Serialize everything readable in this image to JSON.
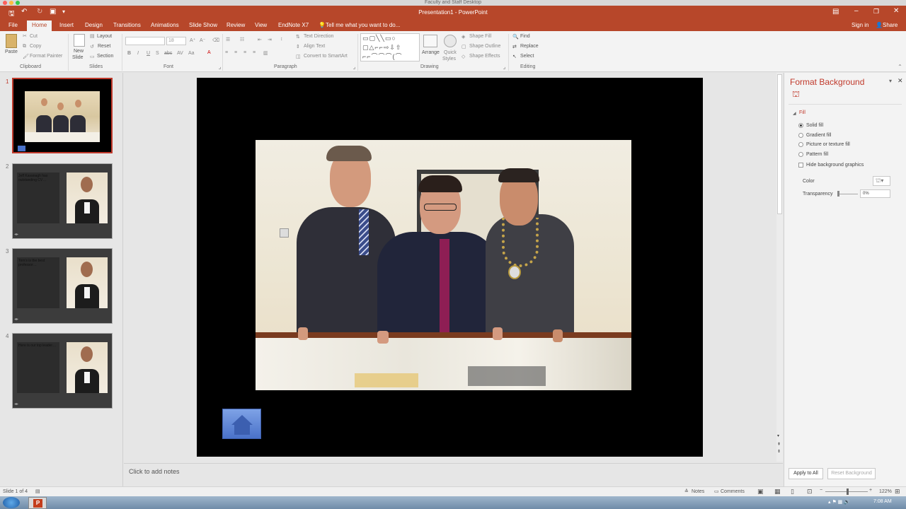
{
  "mac": {
    "title": "Faculty and Staff Desktop"
  },
  "titlebar": {
    "title": "Presentation1 - PowerPoint"
  },
  "tabs": {
    "items": [
      "File",
      "Home",
      "Insert",
      "Design",
      "Transitions",
      "Animations",
      "Slide Show",
      "Review",
      "View",
      "EndNote X7"
    ],
    "active": "Home",
    "tell_me": "Tell me what you want to do...",
    "sign_in": "Sign in",
    "share": "Share"
  },
  "ribbon": {
    "clipboard": {
      "paste": "Paste",
      "cut": "Cut",
      "copy": "Copy",
      "format_painter": "Format Painter",
      "group": "Clipboard"
    },
    "slides": {
      "new_slide": "New",
      "new_slide2": "Slide",
      "layout": "Layout",
      "reset": "Reset",
      "section": "Section",
      "group": "Slides"
    },
    "font": {
      "font_size": "18",
      "bold": "B",
      "italic": "I",
      "underline": "U",
      "strike": "S",
      "group": "Font"
    },
    "paragraph": {
      "text_direction": "Text Direction",
      "align_text": "Align Text",
      "convert_smartart": "Convert to SmartArt",
      "group": "Paragraph"
    },
    "drawing": {
      "arrange": "Arrange",
      "quick_styles": "Quick",
      "quick_styles2": "Styles",
      "shape_fill": "Shape Fill",
      "shape_outline": "Shape Outline",
      "shape_effects": "Shape Effects",
      "group": "Drawing"
    },
    "editing": {
      "find": "Find",
      "replace": "Replace",
      "select": "Select",
      "group": "Editing"
    }
  },
  "thumbs": [
    {
      "num": "1",
      "text": ""
    },
    {
      "num": "2",
      "text": "Jeff Kavanagh has outstanding CV…"
    },
    {
      "num": "3",
      "text": "Tom's is the best professor…"
    },
    {
      "num": "4",
      "text": "Here is our top leader…"
    }
  ],
  "notes": {
    "placeholder": "Click to add notes"
  },
  "pane": {
    "title": "Format Background",
    "fill_header": "Fill",
    "options": [
      "Solid fill",
      "Gradient fill",
      "Picture or texture fill",
      "Pattern fill"
    ],
    "selected": "Solid fill",
    "hide_bg": "Hide background graphics",
    "color_label": "Color",
    "transparency_label": "Transparency",
    "transparency_value": "0%",
    "apply_all": "Apply to All",
    "reset_bg": "Reset Background"
  },
  "status": {
    "slide_of": "Slide 1 of 4",
    "notes": "Notes",
    "comments": "Comments",
    "zoom": "122%"
  },
  "taskbar": {
    "time": "7:08 AM"
  }
}
